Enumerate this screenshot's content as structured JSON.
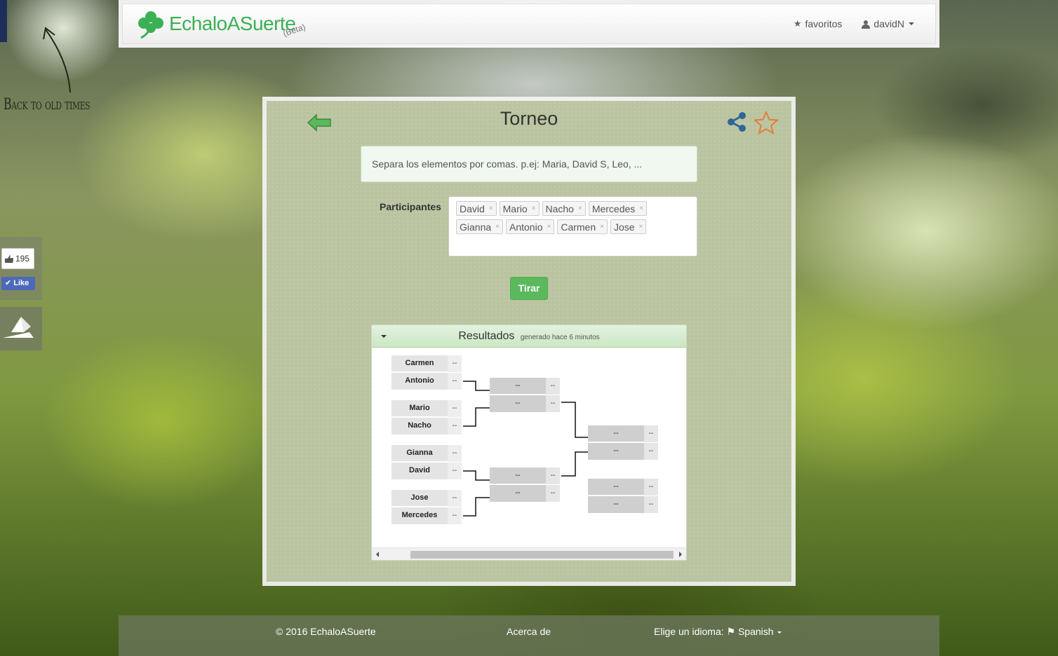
{
  "sidebar": {
    "back_caption": "Back to old times",
    "like_count": "195",
    "like_label": "Like"
  },
  "navbar": {
    "brand": "EchaloASuerte",
    "beta": "(Beta)",
    "favorites": "favoritos",
    "user": "davidN"
  },
  "page": {
    "title": "Torneo",
    "hint": "Separa los elementos por comas. p.ej: Maria, David S, Leo, ...",
    "participants_label": "Participantes",
    "participants": [
      "David",
      "Mario",
      "Nacho",
      "Mercedes",
      "Gianna",
      "Antonio",
      "Carmen",
      "Jose"
    ],
    "tag_remove": "×",
    "submit": "Tirar"
  },
  "results": {
    "title": "Resultados",
    "subtitle": "generado hace 6 minutos",
    "round1": [
      {
        "name": "Carmen",
        "score": "--"
      },
      {
        "name": "Antonio",
        "score": "--"
      },
      {
        "name": "Mario",
        "score": "--"
      },
      {
        "name": "Nacho",
        "score": "--"
      },
      {
        "name": "Gianna",
        "score": "--"
      },
      {
        "name": "David",
        "score": "--"
      },
      {
        "name": "Jose",
        "score": "--"
      },
      {
        "name": "Mercedes",
        "score": "--"
      }
    ],
    "round2": [
      {
        "name": "--",
        "score": "--"
      },
      {
        "name": "--",
        "score": "--"
      },
      {
        "name": "--",
        "score": "--"
      },
      {
        "name": "--",
        "score": "--"
      }
    ],
    "final": [
      {
        "name": "--",
        "score": "--"
      },
      {
        "name": "--",
        "score": "--"
      }
    ],
    "third_place": [
      {
        "name": "--",
        "score": "--"
      },
      {
        "name": "--",
        "score": "--"
      }
    ]
  },
  "footer": {
    "copyright": "© 2016 EchaloASuerte",
    "about": "Acerca de",
    "language_label": "Elige un idioma:",
    "language": "Spanish"
  },
  "colors": {
    "brand_green": "#3cb054",
    "button_green": "#5cb85c",
    "star_outline": "#e0803a",
    "share_blue": "#2f6699"
  }
}
